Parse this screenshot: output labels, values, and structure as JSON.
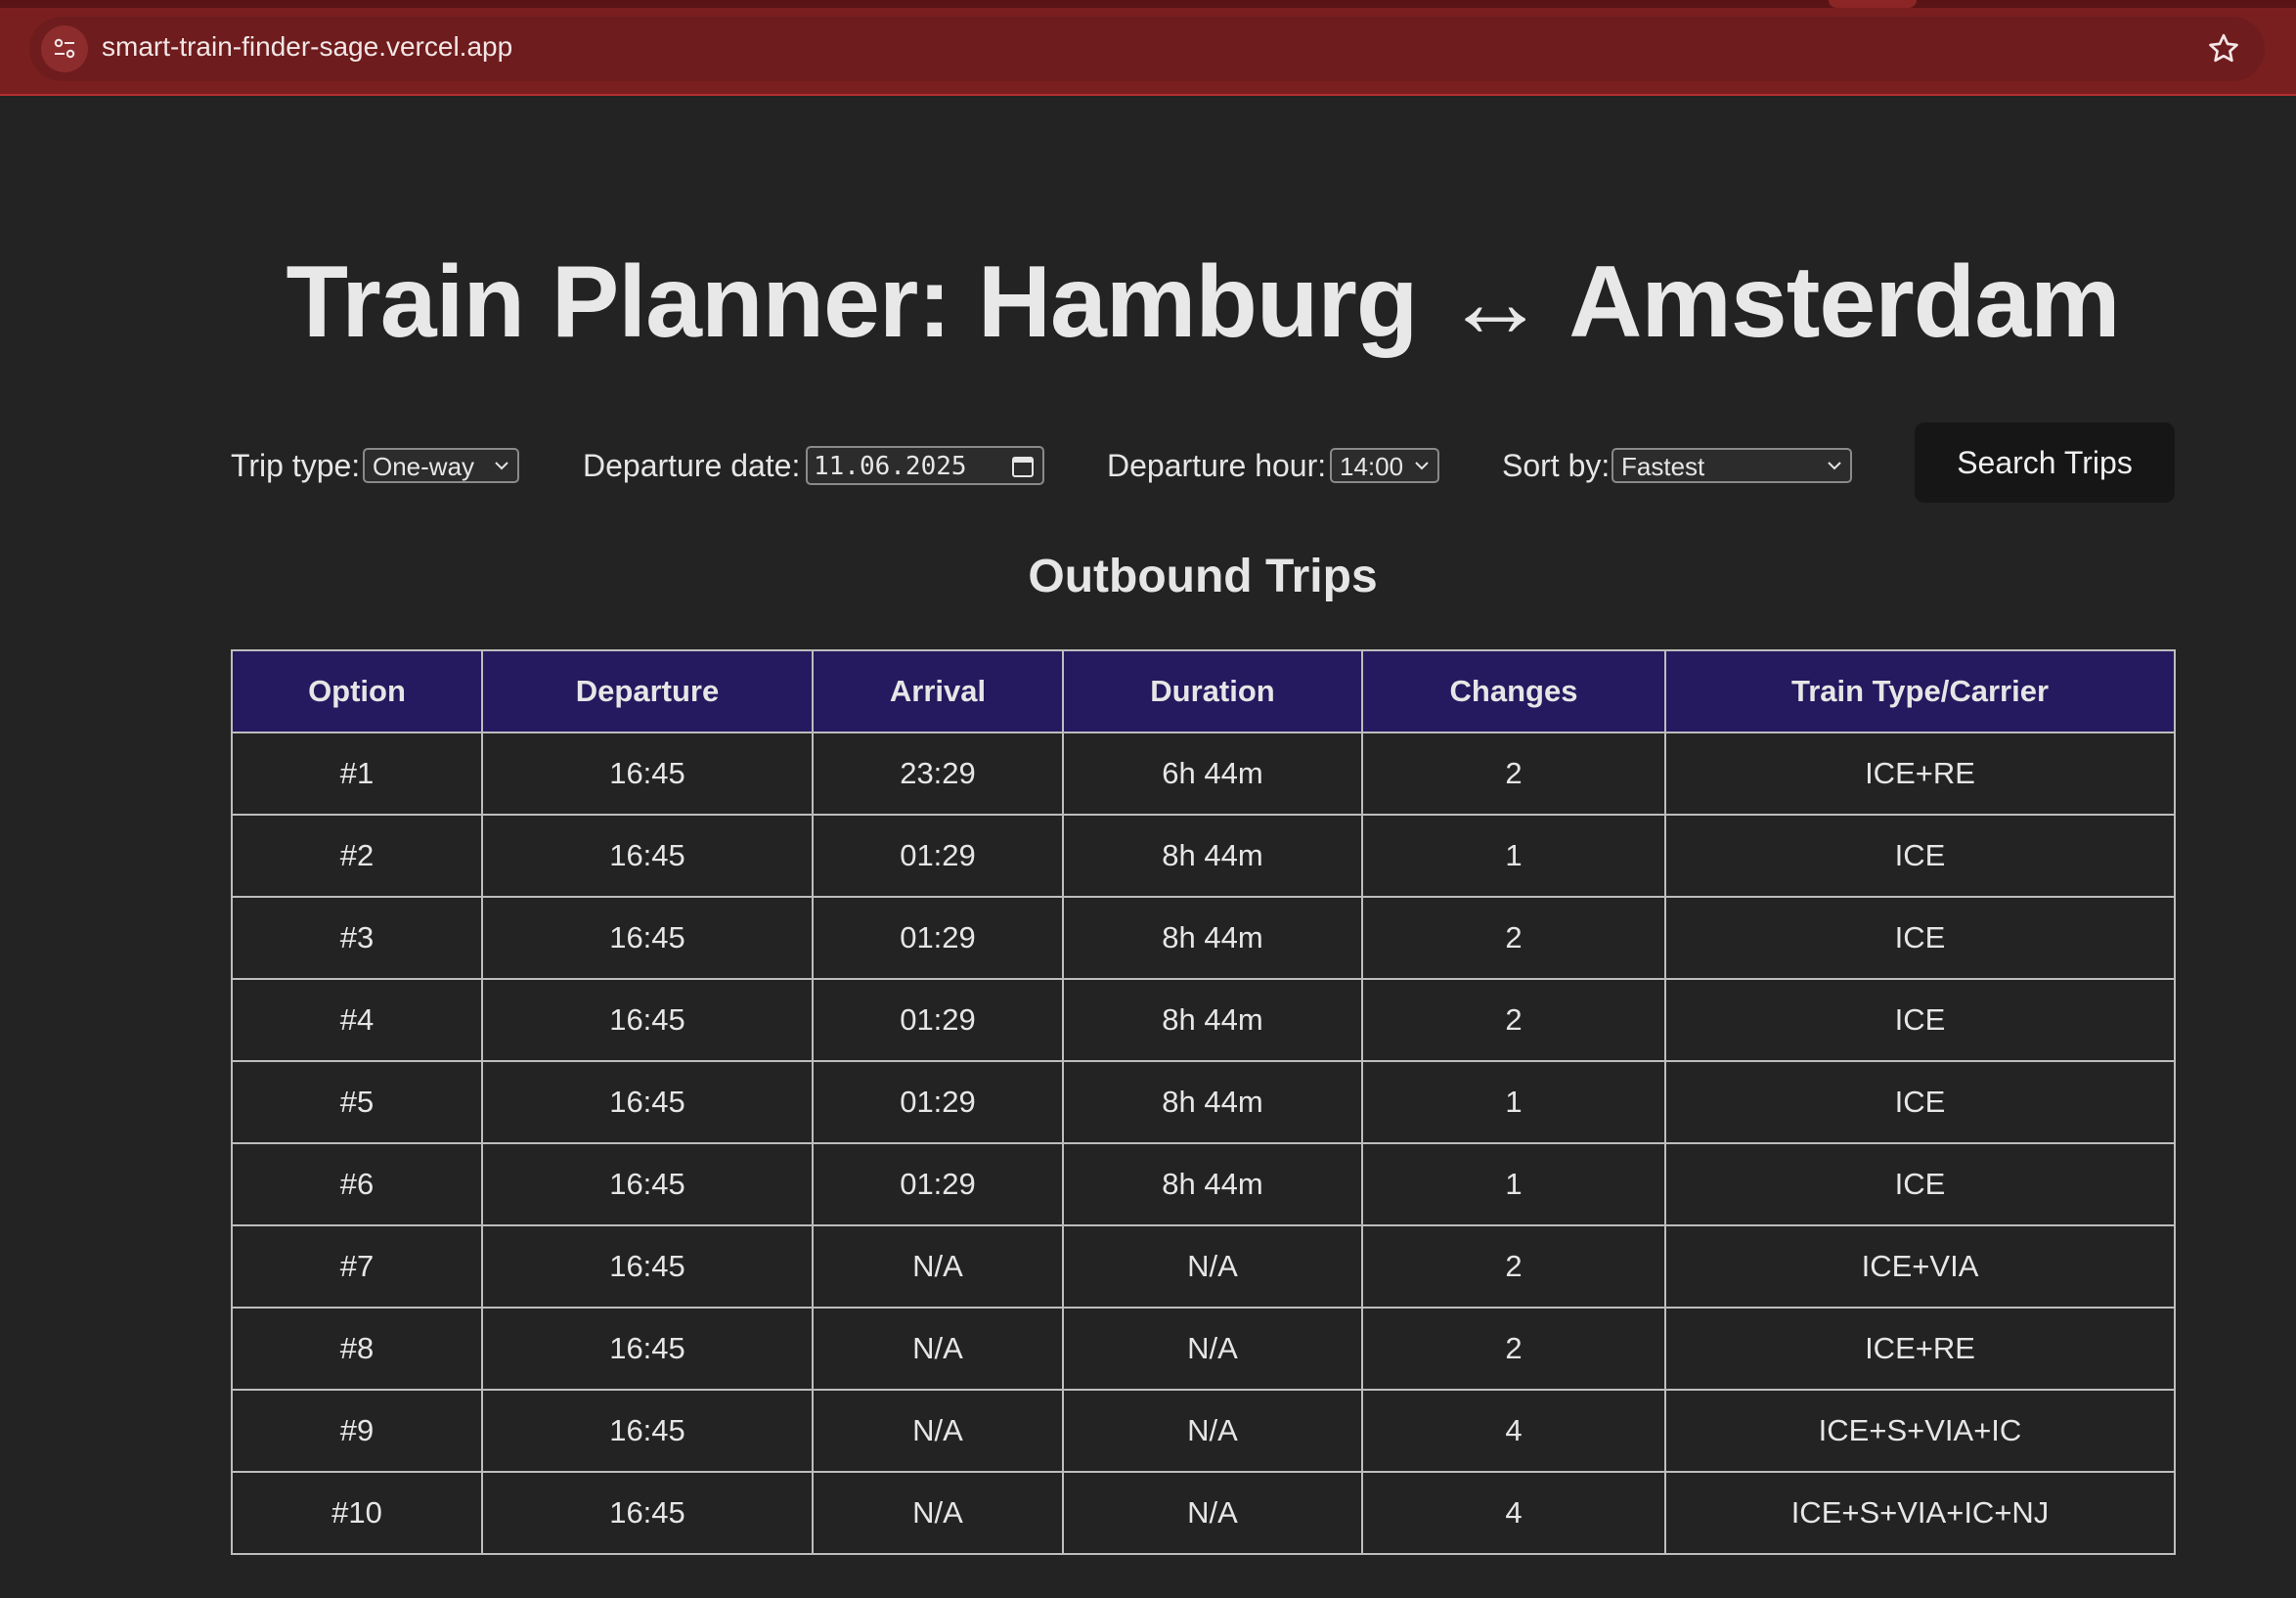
{
  "browser": {
    "url": "smart-train-finder-sage.vercel.app"
  },
  "page": {
    "title": "Train Planner: Hamburg ↔ Amsterdam",
    "controls": {
      "trip_type_label": "Trip type:",
      "trip_type_value": "One-way",
      "departure_date_label": "Departure date:",
      "departure_date_value": "11.06.2025",
      "departure_hour_label": "Departure hour:",
      "departure_hour_value": "14:00",
      "sort_by_label": "Sort by:",
      "sort_by_value": "Fastest",
      "search_button": "Search Trips"
    },
    "section_title": "Outbound Trips",
    "table": {
      "headers": [
        "Option",
        "Departure",
        "Arrival",
        "Duration",
        "Changes",
        "Train Type/Carrier"
      ],
      "rows": [
        [
          "#1",
          "16:45",
          "23:29",
          "6h 44m",
          "2",
          "ICE+RE"
        ],
        [
          "#2",
          "16:45",
          "01:29",
          "8h 44m",
          "1",
          "ICE"
        ],
        [
          "#3",
          "16:45",
          "01:29",
          "8h 44m",
          "2",
          "ICE"
        ],
        [
          "#4",
          "16:45",
          "01:29",
          "8h 44m",
          "2",
          "ICE"
        ],
        [
          "#5",
          "16:45",
          "01:29",
          "8h 44m",
          "1",
          "ICE"
        ],
        [
          "#6",
          "16:45",
          "01:29",
          "8h 44m",
          "1",
          "ICE"
        ],
        [
          "#7",
          "16:45",
          "N/A",
          "N/A",
          "2",
          "ICE+VIA"
        ],
        [
          "#8",
          "16:45",
          "N/A",
          "N/A",
          "2",
          "ICE+RE"
        ],
        [
          "#9",
          "16:45",
          "N/A",
          "N/A",
          "4",
          "ICE+S+VIA+IC"
        ],
        [
          "#10",
          "16:45",
          "N/A",
          "N/A",
          "4",
          "ICE+S+VIA+IC+NJ"
        ]
      ]
    }
  },
  "colors": {
    "chrome_bar": "#7a1f20",
    "page_background": "#232323",
    "table_header": "#25195f",
    "button_background": "#161616"
  }
}
